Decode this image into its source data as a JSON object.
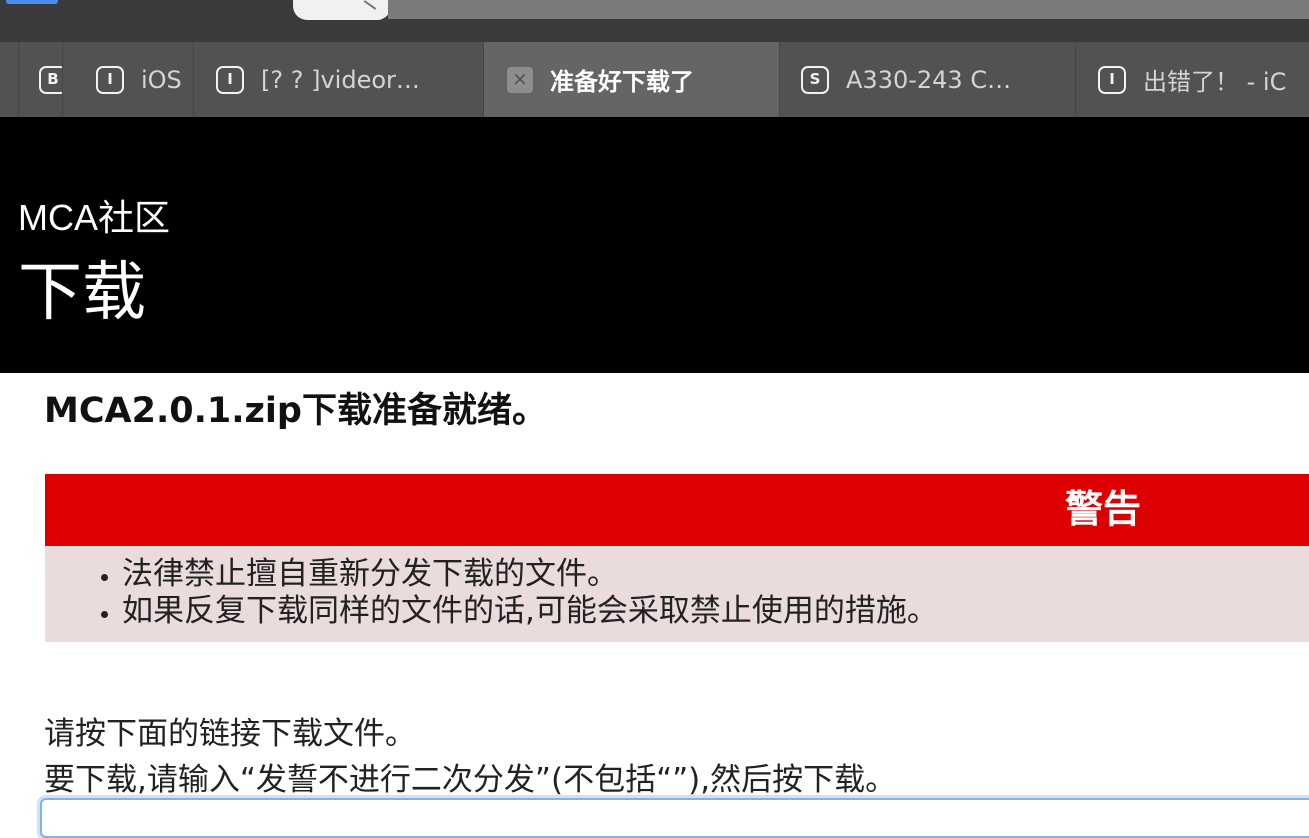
{
  "browser": {
    "tabs": [
      {
        "favicon": "B",
        "label": ""
      },
      {
        "favicon": "I",
        "label": "iOS"
      },
      {
        "favicon": "I",
        "label": "[? ? ]videor…"
      },
      {
        "favicon": "×",
        "label": "准备好下载了",
        "active": true
      },
      {
        "favicon": "S",
        "label": "A330-243 C…"
      },
      {
        "favicon": "I",
        "label": "出错了！ - iC"
      }
    ]
  },
  "header": {
    "site_name": "MCA社区",
    "page_title": "下载"
  },
  "content": {
    "ready_title": "MCA2.0.1.zip下载准备就绪。",
    "warning": {
      "heading": "警告",
      "items": [
        "法律禁止擅自重新分发下载的文件。",
        "如果反复下载同样的文件的话,可能会采取禁止使用的措施。"
      ]
    },
    "instruction_1": "请按下面的链接下载文件。",
    "instruction_2": "要下载,请输入“发誓不进行二次分发”(不包括“”),然后按下载。",
    "confirm_input_value": ""
  },
  "colors": {
    "warning_header": "#dd0000",
    "warning_body": "#eadcdc",
    "site_header": "#000000",
    "tabbar": "#525254"
  }
}
